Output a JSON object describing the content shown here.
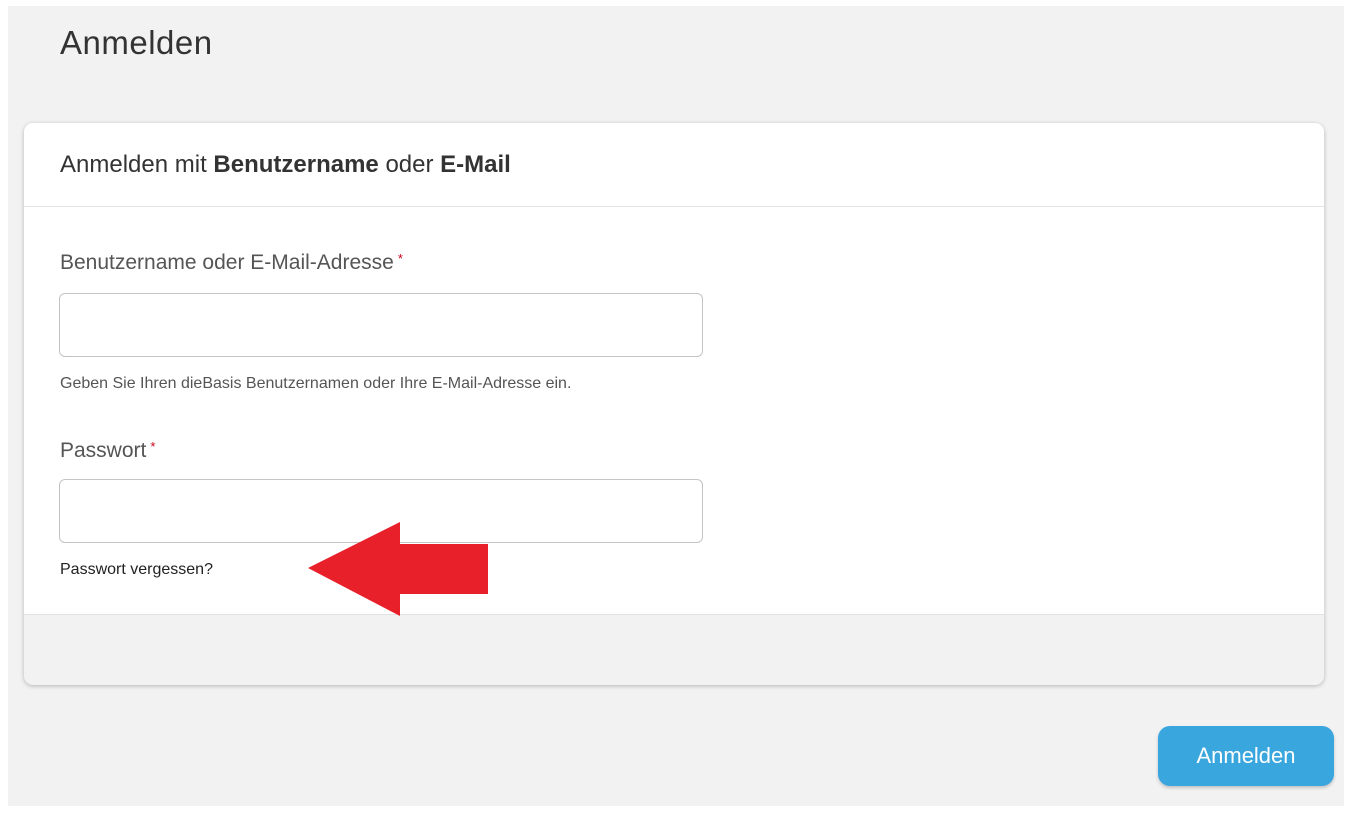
{
  "page": {
    "title": "Anmelden"
  },
  "card": {
    "heading": {
      "prefix": "Anmelden mit ",
      "username": "Benutzername",
      "middle": " oder ",
      "email": "E-Mail"
    }
  },
  "form": {
    "username_label": "Benutzername oder E-Mail-Adresse",
    "required_mark": "*",
    "username_value": "",
    "username_help": "Geben Sie Ihren dieBasis Benutzernamen oder Ihre E-Mail-Adresse ein.",
    "password_label": "Passwort",
    "password_value": "",
    "forgot_link": "Passwort vergessen?"
  },
  "actions": {
    "submit_label": "Anmelden"
  },
  "colors": {
    "accent": "#3aa6de",
    "arrow": "#e8202a",
    "required": "#d0021b"
  }
}
